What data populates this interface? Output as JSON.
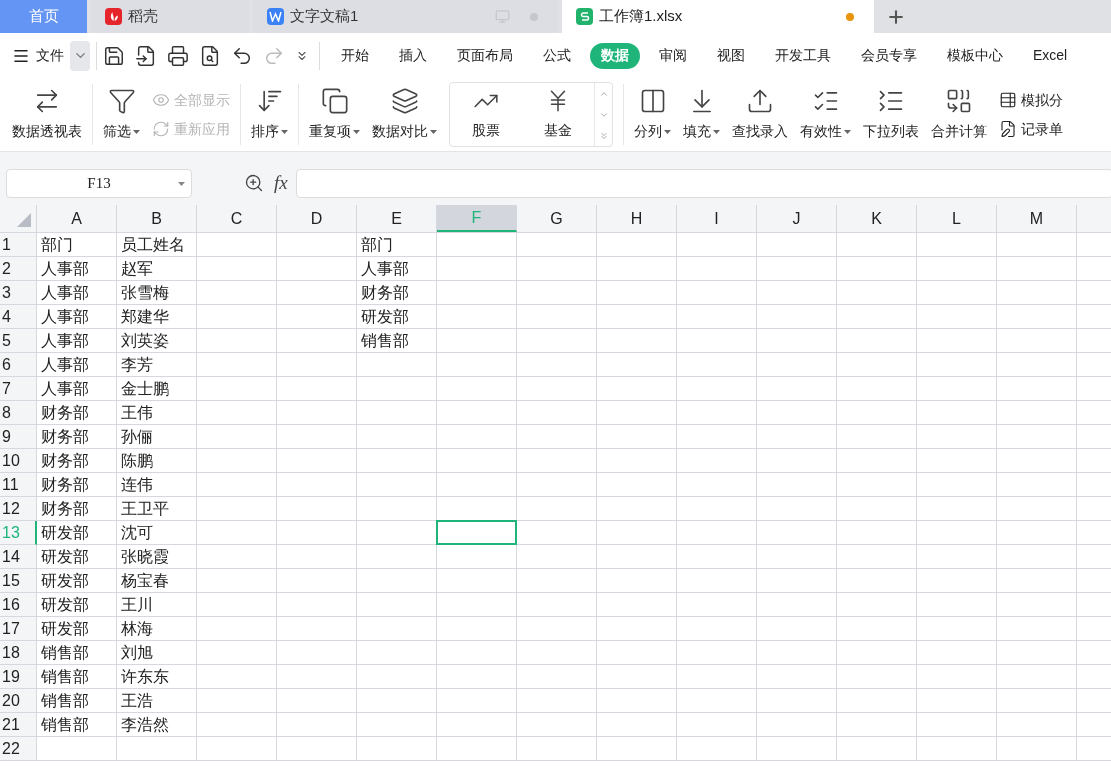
{
  "title_tabs": [
    {
      "label": "首页",
      "kind": "home",
      "selected": false
    },
    {
      "label": "稻壳",
      "kind": "docer",
      "selected": false
    },
    {
      "label": "文字文稿1",
      "kind": "writer",
      "selected": false,
      "modified": false
    },
    {
      "label": "工作簿1.xlsx",
      "kind": "sheet",
      "selected": true,
      "modified": true
    }
  ],
  "menu": {
    "file": "文件",
    "tabs": [
      {
        "label": "开始",
        "selected": false
      },
      {
        "label": "插入",
        "selected": false
      },
      {
        "label": "页面布局",
        "selected": false
      },
      {
        "label": "公式",
        "selected": false
      },
      {
        "label": "数据",
        "selected": true
      },
      {
        "label": "审阅",
        "selected": false
      },
      {
        "label": "视图",
        "selected": false
      },
      {
        "label": "开发工具",
        "selected": false
      },
      {
        "label": "会员专享",
        "selected": false
      },
      {
        "label": "模板中心",
        "selected": false
      },
      {
        "label": "Excel",
        "selected": false
      }
    ]
  },
  "ribbon": [
    {
      "kind": "large",
      "label": "数据透视表",
      "dropdown": false
    },
    {
      "kind": "divider"
    },
    {
      "kind": "large",
      "label": "筛选",
      "dropdown": true
    },
    {
      "kind": "stack",
      "items": [
        {
          "label": "全部显示",
          "disabled": true
        },
        {
          "label": "重新应用",
          "disabled": true
        }
      ]
    },
    {
      "kind": "divider"
    },
    {
      "kind": "large",
      "label": "排序",
      "dropdown": true
    },
    {
      "kind": "divider"
    },
    {
      "kind": "large",
      "label": "重复项",
      "dropdown": true
    },
    {
      "kind": "large",
      "label": "数据对比",
      "dropdown": true
    },
    {
      "kind": "gallery",
      "items": [
        {
          "label": "股票"
        },
        {
          "label": "基金"
        }
      ]
    },
    {
      "kind": "divider"
    },
    {
      "kind": "large",
      "label": "分列",
      "dropdown": true
    },
    {
      "kind": "large",
      "label": "填充",
      "dropdown": true
    },
    {
      "kind": "large",
      "label": "查找录入",
      "dropdown": false
    },
    {
      "kind": "large",
      "label": "有效性",
      "dropdown": true
    },
    {
      "kind": "large",
      "label": "下拉列表",
      "dropdown": false
    },
    {
      "kind": "large",
      "label": "合并计算",
      "dropdown": false
    },
    {
      "kind": "stack",
      "items": [
        {
          "label": "模拟分",
          "disabled": false
        },
        {
          "label": "记录单",
          "disabled": false
        }
      ]
    }
  ],
  "name_box": "F13",
  "formula_label": "fx",
  "columns": [
    {
      "label": "A",
      "selected": false
    },
    {
      "label": "B",
      "selected": false
    },
    {
      "label": "C",
      "selected": false
    },
    {
      "label": "D",
      "selected": false
    },
    {
      "label": "E",
      "selected": false
    },
    {
      "label": "F",
      "selected": true
    },
    {
      "label": "G",
      "selected": false
    },
    {
      "label": "H",
      "selected": false
    },
    {
      "label": "I",
      "selected": false
    },
    {
      "label": "J",
      "selected": false
    },
    {
      "label": "K",
      "selected": false
    },
    {
      "label": "L",
      "selected": false
    },
    {
      "label": "M",
      "selected": false
    }
  ],
  "rows": [
    {
      "number": "1",
      "selected": false,
      "column_a": "部门",
      "column_b": "员工姓名",
      "column_e": "部门"
    },
    {
      "number": "2",
      "selected": false,
      "column_a": "人事部",
      "column_b": "赵军",
      "column_e": "人事部"
    },
    {
      "number": "3",
      "selected": false,
      "column_a": "人事部",
      "column_b": "张雪梅",
      "column_e": "财务部"
    },
    {
      "number": "4",
      "selected": false,
      "column_a": "人事部",
      "column_b": "郑建华",
      "column_e": "研发部"
    },
    {
      "number": "5",
      "selected": false,
      "column_a": "人事部",
      "column_b": "刘英姿",
      "column_e": "销售部"
    },
    {
      "number": "6",
      "selected": false,
      "column_a": "人事部",
      "column_b": "李芳"
    },
    {
      "number": "7",
      "selected": false,
      "column_a": "人事部",
      "column_b": "金士鹏"
    },
    {
      "number": "8",
      "selected": false,
      "column_a": "财务部",
      "column_b": "王伟"
    },
    {
      "number": "9",
      "selected": false,
      "column_a": "财务部",
      "column_b": "孙俪"
    },
    {
      "number": "10",
      "selected": false,
      "column_a": "财务部",
      "column_b": "陈鹏"
    },
    {
      "number": "11",
      "selected": false,
      "column_a": "财务部",
      "column_b": "连伟"
    },
    {
      "number": "12",
      "selected": false,
      "column_a": "财务部",
      "column_b": "王卫平"
    },
    {
      "number": "13",
      "selected": true,
      "column_a": "研发部",
      "column_b": "沈可"
    },
    {
      "number": "14",
      "selected": false,
      "column_a": "研发部",
      "column_b": "张晓霞"
    },
    {
      "number": "15",
      "selected": false,
      "column_a": "研发部",
      "column_b": "杨宝春"
    },
    {
      "number": "16",
      "selected": false,
      "column_a": "研发部",
      "column_b": "王川"
    },
    {
      "number": "17",
      "selected": false,
      "column_a": "研发部",
      "column_b": "林海"
    },
    {
      "number": "18",
      "selected": false,
      "column_a": "销售部",
      "column_b": "刘旭"
    },
    {
      "number": "19",
      "selected": false,
      "column_a": "销售部",
      "column_b": "许东东"
    },
    {
      "number": "20",
      "selected": false,
      "column_a": "销售部",
      "column_b": "王浩"
    },
    {
      "number": "21",
      "selected": false,
      "column_a": "销售部",
      "column_b": "李浩然"
    },
    {
      "number": "22",
      "selected": false
    }
  ]
}
